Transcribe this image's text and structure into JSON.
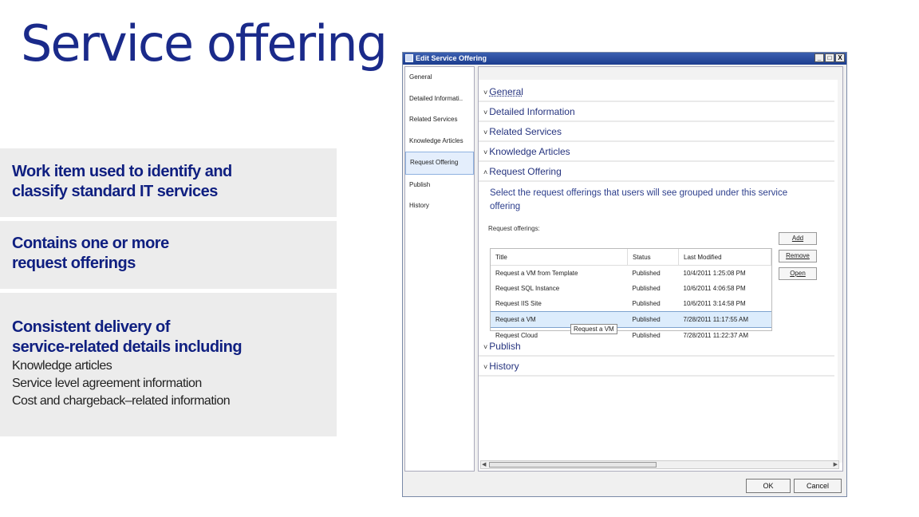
{
  "slide": {
    "title": "Service offering",
    "panels": [
      {
        "heading_line1": "Work item used to identify and",
        "heading_line2": "classify standard IT services"
      },
      {
        "heading_line1": "Contains one or more",
        "heading_line2": "request offerings"
      },
      {
        "heading_line1": "Consistent delivery of",
        "heading_line2": "service-related details including",
        "bullets": [
          "Knowledge articles",
          "Service level agreement information",
          "Cost and chargeback–related information"
        ]
      }
    ]
  },
  "dialog": {
    "title": "Edit Service Offering",
    "window_buttons": [
      "_",
      "□",
      "X"
    ],
    "nav": [
      "General",
      "Detailed Informati..",
      "Related Services",
      "Knowledge Articles",
      "Request Offering",
      "Publish",
      "History"
    ],
    "nav_selected": "Request Offering",
    "sections_top": [
      {
        "chevron": "˅",
        "label": "General"
      },
      {
        "chevron": "˅",
        "label": "Detailed Information"
      },
      {
        "chevron": "˅",
        "label": "Related Services"
      },
      {
        "chevron": "˅",
        "label": "Knowledge Articles"
      },
      {
        "chevron": "˄",
        "label": "Request Offering"
      }
    ],
    "description": "Select the request offerings that users will see grouped under this service offering",
    "grid_label": "Request offerings:",
    "grid": {
      "columns": [
        "Title",
        "Status",
        "Last Modified"
      ],
      "rows": [
        [
          "Request a VM from Template",
          "Published",
          "10/4/2011 1:25:08 PM"
        ],
        [
          "Request SQL Instance",
          "Published",
          "10/6/2011 4:06:58 PM"
        ],
        [
          "Request IIS Site",
          "Published",
          "10/6/2011 3:14:58 PM"
        ],
        [
          "Request a VM",
          "Published",
          "7/28/2011 11:17:55 AM"
        ],
        [
          "Request Cloud",
          "Published",
          "7/28/2011 11:22:37 AM"
        ]
      ],
      "selected_row": 3,
      "tooltip": "Request a VM"
    },
    "side_buttons": [
      "Add",
      "Remove",
      "Open"
    ],
    "sections_bottom": [
      {
        "chevron": "˅",
        "label": "Publish"
      },
      {
        "chevron": "˅",
        "label": "History"
      }
    ],
    "ok_label": "OK",
    "cancel_label": "Cancel"
  }
}
